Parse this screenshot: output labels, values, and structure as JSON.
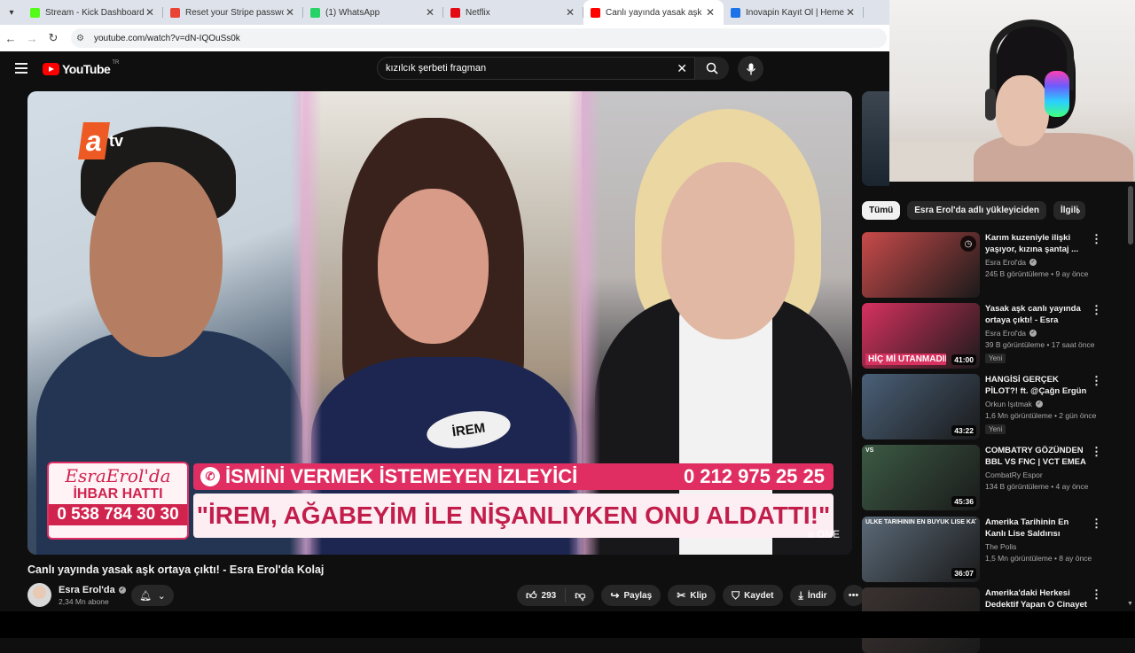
{
  "browser": {
    "tabs": [
      {
        "title": "Stream - Kick Dashboard",
        "favicon_color": "#53fc18",
        "active": false
      },
      {
        "title": "Reset your Stripe password - n",
        "favicon_color": "#ea4335",
        "active": false
      },
      {
        "title": "(1) WhatsApp",
        "favicon_color": "#25d366",
        "active": false
      },
      {
        "title": "Netflix",
        "favicon_color": "#e50914",
        "active": false
      },
      {
        "title": "Canlı yayında yasak aşk orta",
        "favicon_color": "#ff0000",
        "active": true
      },
      {
        "title": "İnovapin Kayıt Ol | Hemen Üye",
        "favicon_color": "#1a73e8",
        "active": false
      }
    ],
    "url": "youtube.com/watch?v=dN-IQOuSs0k"
  },
  "youtube": {
    "logo_text": "YouTube",
    "country_code": "TR",
    "search_value": "kızılcık şerbeti fragman"
  },
  "video": {
    "banner_brand": "EsraErol'da",
    "banner_hotline_label": "İHBAR HATTI",
    "banner_hotline_number": "0 538 784 30 30",
    "banner_top_text": "İSMİNİ VERMEK İSTEMEYEN İZLEYİCİ",
    "banner_top_number": "0 212 975 25 25",
    "banner_quote": "\"İREM, AĞABEYİM İLE NİŞANLIYKEN ONU ALDATTI!\"",
    "name_tag": "İREM",
    "channel_logo": "tv",
    "title": "Canlı yayında yasak aşk ortaya çıktı! - Esra Erol'da Kolaj",
    "channel": "Esra Erol'da",
    "subscribers": "2,34 Mn abone",
    "likes": "293",
    "share": "Paylaş",
    "clip": "Klip",
    "save": "Kaydet",
    "download": "İndir"
  },
  "chips": [
    "Tümü",
    "Esra Erol'da adlı yükleyiciden",
    "İlgili"
  ],
  "recommendations": [
    {
      "title": "Karım kuzeniyle ilişki yaşıyor, kızına şantaj ...",
      "channel": "Esra Erol'da",
      "meta": "245 B görüntüleme • 9 ay önce",
      "duration": "",
      "is_new": false,
      "thumb_color": "#c94a4a"
    },
    {
      "title": "Yasak aşk canlı yayında ortaya çıktı! - Esra Erol'da...",
      "channel": "Esra Erol'da",
      "meta": "39 B görüntüleme • 17 saat önce",
      "duration": "41:00",
      "is_new": true,
      "new_label": "Yeni",
      "thumb_color": "#d6315f",
      "thumb_text": "HİÇ Mİ UTANMADIN?"
    },
    {
      "title": "HANGİSİ GERÇEK PİLOT?! ft. @Çağn Ergün",
      "channel": "Orkun Işıtmak",
      "meta": "1,6 Mn görüntüleme • 2 gün önce",
      "duration": "43:22",
      "is_new": true,
      "new_label": "Yeni",
      "thumb_color": "#4a6078"
    },
    {
      "title": "COMBATRY GÖZÜNDEN BBL VS FNC | VCT EMEA ...",
      "channel": "CombatRy Espor",
      "meta": "134 B görüntüleme • 4 ay önce",
      "duration": "45:36",
      "is_new": false,
      "thumb_color": "#3c5a44",
      "thumb_text": "VS"
    },
    {
      "title": "Amerika Tarihinin En Kanlı Lise Saldırısı",
      "channel": "The Polis",
      "meta": "1,5 Mn görüntüleme • 8 ay önce",
      "duration": "36:07",
      "is_new": false,
      "thumb_color": "#5b6a78",
      "thumb_text": "ÜLKE TARİHİNİN EN BÜYÜK LİSE KATLİAMI"
    },
    {
      "title": "Amerika'daki Herkesi Dedektif Yapan O Cinayet",
      "channel": "",
      "meta": "",
      "duration": "",
      "is_new": false,
      "thumb_color": "#3a3230"
    }
  ]
}
